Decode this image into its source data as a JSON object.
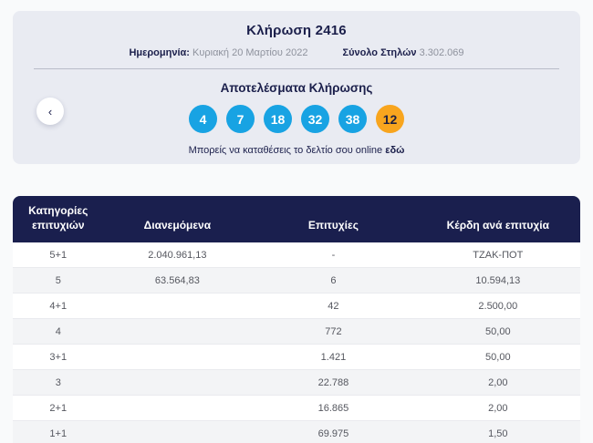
{
  "draw": {
    "title": "Κλήρωση 2416",
    "date_label": "Ημερομηνία:",
    "date_value": "Κυριακή 20 Μαρτίου 2022",
    "columns_label": "Σύνολο Στηλών",
    "columns_value": "3.302.069",
    "results_title": "Αποτελέσματα Κλήρωσης",
    "numbers": [
      "4",
      "7",
      "18",
      "32",
      "38"
    ],
    "tzoker_number": "12",
    "prev_button_glyph": "‹",
    "footer_text": "Μπορείς να καταθέσεις το δελτίο σου online ",
    "footer_link": "εδώ"
  },
  "colors": {
    "ball_blue": "#18a3e3",
    "ball_orange": "#f8a51e",
    "header_navy": "#1a1f4e",
    "panel_bg": "#e9ebf2"
  },
  "table": {
    "headers": [
      "Κατηγορίες επιτυχιών",
      "Διανεμόμενα",
      "Επιτυχίες",
      "Κέρδη ανά επιτυχία"
    ],
    "rows": [
      [
        "5+1",
        "2.040.961,13",
        "-",
        "ΤΖΑΚ-ΠΟΤ"
      ],
      [
        "5",
        "63.564,83",
        "6",
        "10.594,13"
      ],
      [
        "4+1",
        "",
        "42",
        "2.500,00"
      ],
      [
        "4",
        "",
        "772",
        "50,00"
      ],
      [
        "3+1",
        "",
        "1.421",
        "50,00"
      ],
      [
        "3",
        "",
        "22.788",
        "2,00"
      ],
      [
        "2+1",
        "",
        "16.865",
        "2,00"
      ],
      [
        "1+1",
        "",
        "69.975",
        "1,50"
      ]
    ]
  }
}
